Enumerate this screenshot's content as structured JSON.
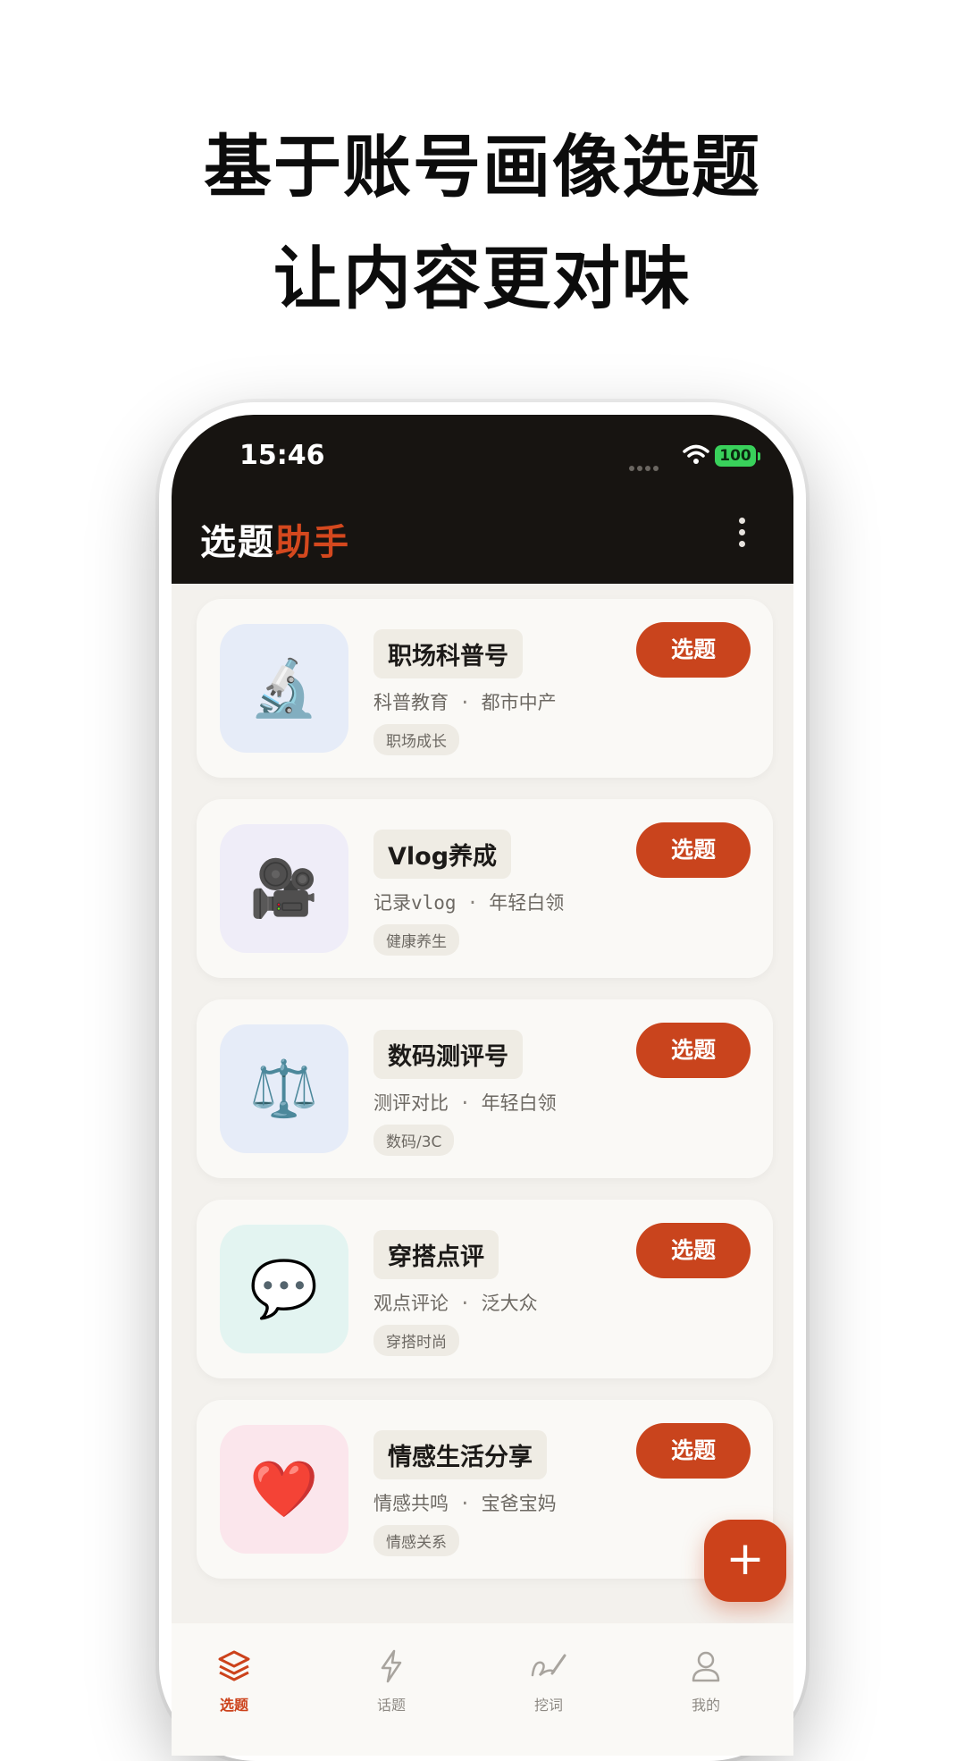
{
  "headline": {
    "line1": "基于账号画像选题",
    "line2": "让内容更对味"
  },
  "status_bar": {
    "time": "15:46",
    "battery": "100"
  },
  "header": {
    "title_part1": "选题",
    "title_part2": "助手",
    "menu_icon": "more-vertical-icon"
  },
  "cards": [
    {
      "name": "职场科普号",
      "meta1": "科普教育",
      "meta2": "都市中产",
      "tag": "职场成长",
      "button": "选题",
      "icon": "🔬",
      "icon_name": "microscope-icon",
      "bg": "#e6ecf8"
    },
    {
      "name": "Vlog养成",
      "meta1": "记录vlog",
      "meta2": "年轻白领",
      "tag": "健康养生",
      "button": "选题",
      "icon": "🎥",
      "icon_name": "movie-camera-icon",
      "bg": "#efedf8"
    },
    {
      "name": "数码测评号",
      "meta1": "测评对比",
      "meta2": "年轻白领",
      "tag": "数码/3C",
      "button": "选题",
      "icon": "⚖️",
      "icon_name": "balance-scale-icon",
      "bg": "#e6ecf8"
    },
    {
      "name": "穿搭点评",
      "meta1": "观点评论",
      "meta2": "泛大众",
      "tag": "穿搭时尚",
      "button": "选题",
      "icon": "💬",
      "icon_name": "speech-bubble-icon",
      "bg": "#e3f4f1"
    },
    {
      "name": "情感生活分享",
      "meta1": "情感共鸣",
      "meta2": "宝爸宝妈",
      "tag": "情感关系",
      "button": "选题",
      "icon": "❤️",
      "icon_name": "heart-icon",
      "bg": "#fbe6ec"
    }
  ],
  "fab": {
    "label": "+"
  },
  "tabs": [
    {
      "label": "选题",
      "icon": "layers-icon",
      "active": true
    },
    {
      "label": "话题",
      "icon": "lightning-icon",
      "active": false
    },
    {
      "label": "挖词",
      "icon": "pen-icon",
      "active": false
    },
    {
      "label": "我的",
      "icon": "user-icon",
      "active": false
    }
  ],
  "colors": {
    "accent": "#cc421b",
    "header_bg": "#171411",
    "screen_bg": "#f3f1ed",
    "card_bg": "#faf9f6"
  }
}
